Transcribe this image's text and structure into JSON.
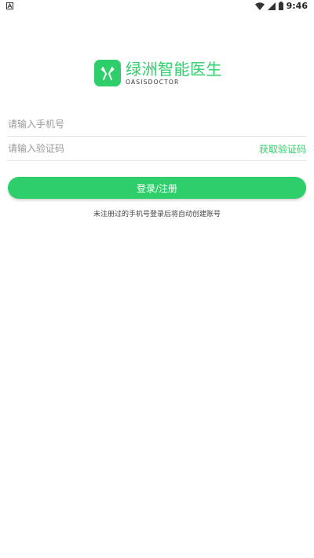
{
  "status_bar": {
    "time": "9:46",
    "left_icon": "notification-a-icon",
    "icons": [
      "wifi-icon",
      "cellular-signal-icon",
      "battery-icon"
    ]
  },
  "brand": {
    "name": "绿洲智能医生",
    "subtitle": "OASISDOCTOR",
    "logo_icon": "fork-knife-icon",
    "color": "#2ecf6a"
  },
  "form": {
    "phone_placeholder": "请输入手机号",
    "phone_value": "",
    "code_placeholder": "请输入验证码",
    "code_value": "",
    "get_code_label": "获取验证码",
    "submit_label": "登录/注册"
  },
  "hint_text": "未注册过的手机号登录后将自动创建账号"
}
